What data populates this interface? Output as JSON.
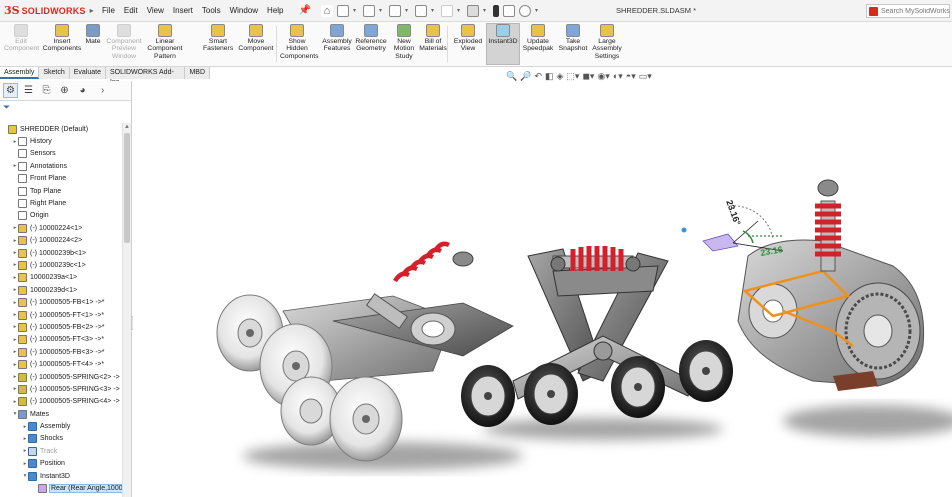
{
  "app": {
    "brand": "SOLIDWORKS",
    "brand_prefix": "3S",
    "window_title": "SHREDDER.SLDASM *"
  },
  "menu": [
    "File",
    "Edit",
    "View",
    "Insert",
    "Tools",
    "Window",
    "Help"
  ],
  "search": {
    "placeholder": "Search MySolidWorks"
  },
  "ribbon": [
    {
      "label": "Edit\nComponent",
      "icon": "edit-component-icon",
      "disabled": true
    },
    {
      "label": "Insert\nComponents",
      "icon": "insert-components-icon",
      "disabled": false
    },
    {
      "label": "Mate",
      "icon": "mate-icon",
      "disabled": false
    },
    {
      "label": "Component\nPreview\nWindow",
      "icon": "component-preview-icon",
      "disabled": true
    },
    {
      "label": "Linear Component\nPattern",
      "icon": "linear-pattern-icon",
      "disabled": false
    },
    {
      "label": "Smart\nFasteners",
      "icon": "smart-fasteners-icon",
      "disabled": false
    },
    {
      "label": "Move\nComponent",
      "icon": "move-component-icon",
      "disabled": false
    },
    {
      "label": "Show\nHidden\nComponents",
      "icon": "show-hidden-icon",
      "disabled": false
    },
    {
      "label": "Assembly\nFeatures",
      "icon": "assembly-features-icon",
      "disabled": false
    },
    {
      "label": "Reference\nGeometry",
      "icon": "reference-geometry-icon",
      "disabled": false
    },
    {
      "label": "New\nMotion\nStudy",
      "icon": "motion-study-icon",
      "disabled": false
    },
    {
      "label": "Bill of\nMaterials",
      "icon": "bom-icon",
      "disabled": false
    },
    {
      "label": "Exploded\nView",
      "icon": "exploded-view-icon",
      "disabled": false
    },
    {
      "label": "Instant3D",
      "icon": "instant3d-icon",
      "disabled": false,
      "active": true
    },
    {
      "label": "Update\nSpeedpak",
      "icon": "speedpak-icon",
      "disabled": false
    },
    {
      "label": "Take\nSnapshot",
      "icon": "snapshot-icon",
      "disabled": false
    },
    {
      "label": "Large\nAssembly\nSettings",
      "icon": "large-assembly-icon",
      "disabled": false
    }
  ],
  "tabs": [
    "Assembly",
    "Sketch",
    "Evaluate",
    "SOLIDWORKS Add-Ins",
    "MBD"
  ],
  "tree": [
    {
      "label": "SHREDDER  (Default)",
      "level": 0,
      "icon": "assembly-icon",
      "twisty": ""
    },
    {
      "label": "History",
      "level": 1,
      "icon": "history-icon",
      "twisty": "▸"
    },
    {
      "label": "Sensors",
      "level": 1,
      "icon": "sensors-icon",
      "twisty": ""
    },
    {
      "label": "Annotations",
      "level": 1,
      "icon": "annotations-icon",
      "twisty": "▸"
    },
    {
      "label": "Front Plane",
      "level": 1,
      "icon": "plane-icon",
      "twisty": ""
    },
    {
      "label": "Top Plane",
      "level": 1,
      "icon": "plane-icon",
      "twisty": ""
    },
    {
      "label": "Right Plane",
      "level": 1,
      "icon": "plane-icon",
      "twisty": ""
    },
    {
      "label": "Origin",
      "level": 1,
      "icon": "origin-icon",
      "twisty": ""
    },
    {
      "label": "(-) 10000224<1>",
      "level": 1,
      "icon": "part-icon",
      "twisty": "▸"
    },
    {
      "label": "(-) 10000224<2>",
      "level": 1,
      "icon": "part-icon",
      "twisty": "▸"
    },
    {
      "label": "(-) 10000239b<1>",
      "level": 1,
      "icon": "part-icon",
      "twisty": "▸"
    },
    {
      "label": "(-) 10000239c<1>",
      "level": 1,
      "icon": "part-icon",
      "twisty": "▸"
    },
    {
      "label": "10000239a<1>",
      "level": 1,
      "icon": "part-icon",
      "twisty": "▸"
    },
    {
      "label": "10000239d<1>",
      "level": 1,
      "icon": "part-icon",
      "twisty": "▸"
    },
    {
      "label": "(-) 10000505-FB<1> ->*",
      "level": 1,
      "icon": "subassembly-icon",
      "twisty": "▸"
    },
    {
      "label": "(-) 10000505-FT<1> ->*",
      "level": 1,
      "icon": "subassembly-icon",
      "twisty": "▸"
    },
    {
      "label": "(-) 10000505-FB<2> ->*",
      "level": 1,
      "icon": "subassembly-icon",
      "twisty": "▸"
    },
    {
      "label": "(-) 10000505-FT<3> ->*",
      "level": 1,
      "icon": "subassembly-icon",
      "twisty": "▸"
    },
    {
      "label": "(-) 10000505-FB<3> ->*",
      "level": 1,
      "icon": "subassembly-icon",
      "twisty": "▸"
    },
    {
      "label": "(-) 10000505-FT<4> ->*",
      "level": 1,
      "icon": "subassembly-icon",
      "twisty": "▸"
    },
    {
      "label": "(-) 10000505-SPRING<2> ->",
      "level": 1,
      "icon": "spring-icon",
      "twisty": "▸"
    },
    {
      "label": "(-) 10000505-SPRING<3> ->",
      "level": 1,
      "icon": "spring-icon",
      "twisty": "▸"
    },
    {
      "label": "(-) 10000505-SPRING<4> ->",
      "level": 1,
      "icon": "spring-icon",
      "twisty": "▸"
    },
    {
      "label": "Mates",
      "level": 1,
      "icon": "mates-icon",
      "twisty": "▾"
    },
    {
      "label": "Assembly",
      "level": 2,
      "icon": "folder-icon",
      "twisty": "▸"
    },
    {
      "label": "Shocks",
      "level": 2,
      "icon": "folder-icon",
      "twisty": "▸"
    },
    {
      "label": "Track",
      "level": 2,
      "icon": "folder-icon",
      "twisty": "▸",
      "disabled": true
    },
    {
      "label": "Position",
      "level": 2,
      "icon": "folder-icon",
      "twisty": "▸"
    },
    {
      "label": "Instant3D",
      "level": 2,
      "icon": "folder-icon",
      "twisty": "▾"
    },
    {
      "label": "Rear (Rear Angle,10000:",
      "level": 3,
      "icon": "angle-mate-icon",
      "twisty": "",
      "selected": true
    }
  ],
  "dimensions": {
    "angle": "23.16°",
    "distance": "23.16"
  },
  "colors": {
    "brand": "#d92a1c",
    "spring": "#d4202a",
    "selection": "#cfe3f7",
    "accent": "#3a6fb0"
  }
}
